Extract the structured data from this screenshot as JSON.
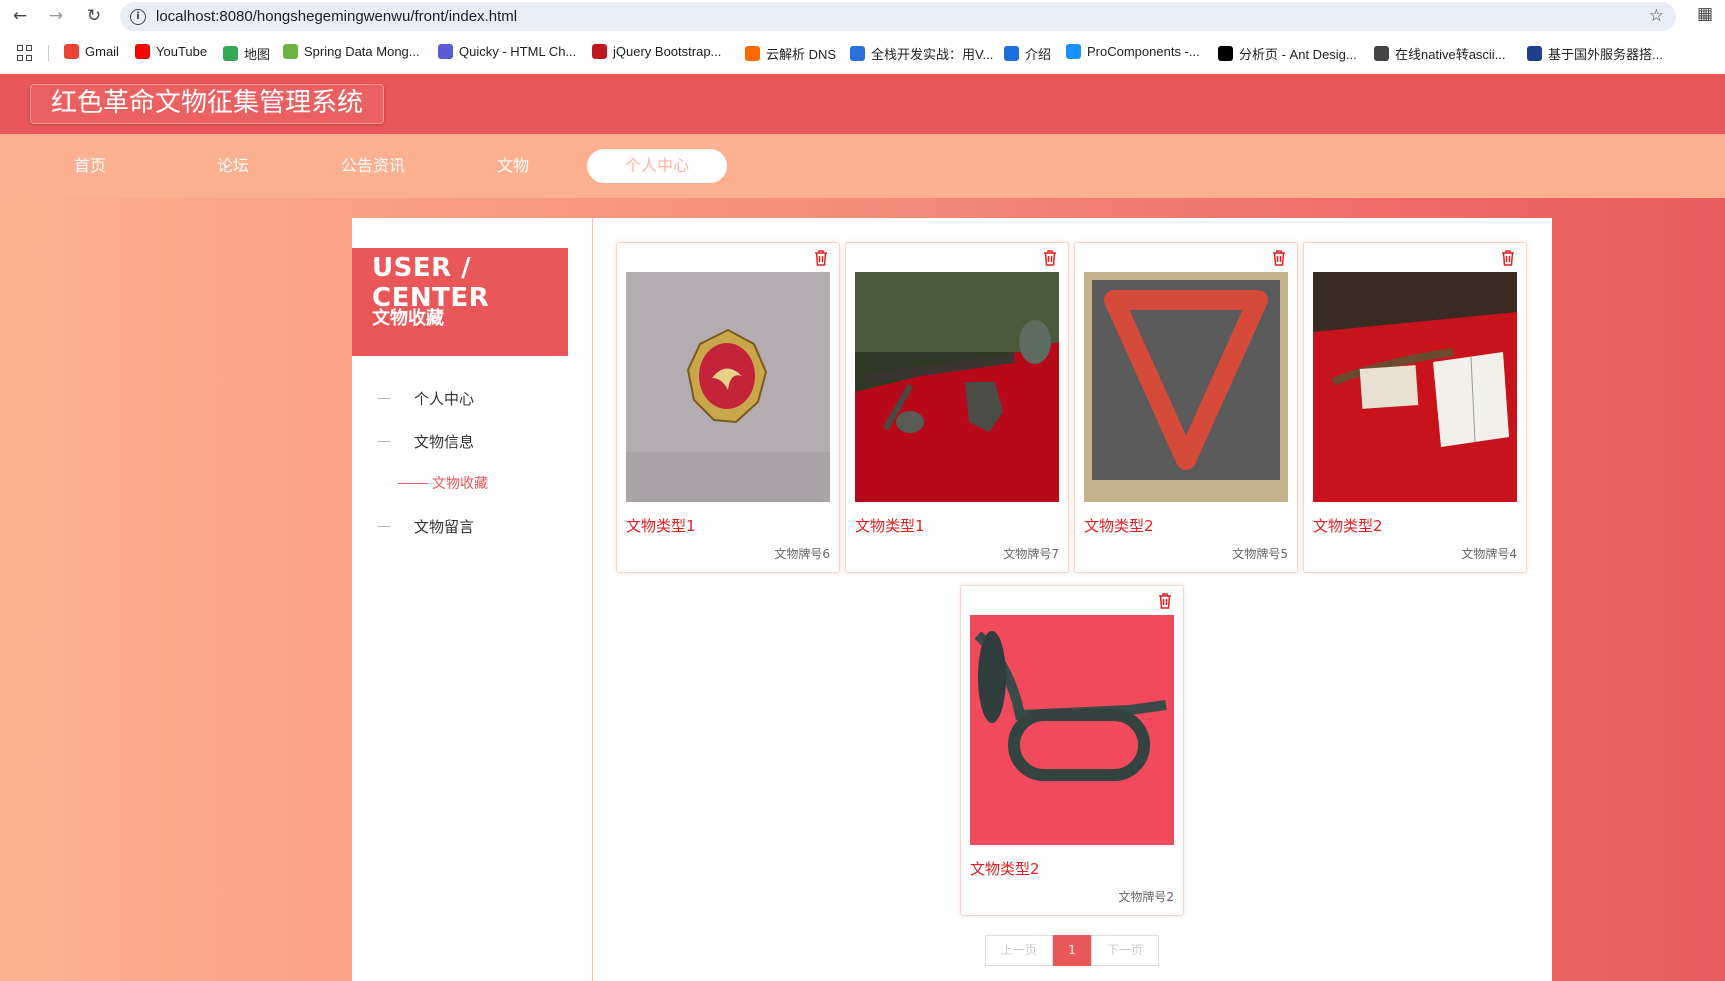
{
  "browser": {
    "url": "localhost:8080/hongshegemingwenwu/front/index.html",
    "bookmarks": [
      {
        "label": "Gmail",
        "icon": "gmail-icon",
        "color": "#ea4335"
      },
      {
        "label": "YouTube",
        "icon": "youtube-icon",
        "color": "#ff0000"
      },
      {
        "label": "地图",
        "icon": "maps-icon",
        "color": "#34a853"
      },
      {
        "label": "Spring Data Mong...",
        "icon": "spring-icon",
        "color": "#6db33f"
      },
      {
        "label": "Quicky - HTML Ch...",
        "icon": "messenger-icon",
        "color": "#5b5bd6"
      },
      {
        "label": "jQuery Bootstrap...",
        "icon": "jquery-icon",
        "color": "#c0161d"
      },
      {
        "label": "云解析 DNS",
        "icon": "aliyun-icon",
        "color": "#ff6a00"
      },
      {
        "label": "全栈开发实战：用V...",
        "icon": "m-icon",
        "color": "#2a6fdb"
      },
      {
        "label": "介绍",
        "icon": "globe-icon",
        "color": "#1e6fd9"
      },
      {
        "label": "ProComponents -...",
        "icon": "procomponents-icon",
        "color": "#1890ff"
      },
      {
        "label": "分析页 - Ant Desig...",
        "icon": "pro-icon",
        "color": "#000000"
      },
      {
        "label": "在线native转ascii...",
        "icon": "github-icon",
        "color": "#444444"
      },
      {
        "label": "基于国外服务器搭...",
        "icon": "docker-icon",
        "color": "#1d3f8c"
      }
    ]
  },
  "header": {
    "title": "红色革命文物征集管理系统"
  },
  "nav": {
    "items": [
      "首页",
      "论坛",
      "公告资讯",
      "文物",
      "个人中心"
    ],
    "active_index": 4
  },
  "sidebar": {
    "uc_title": "USER / CENTER",
    "uc_subtitle": "文物收藏",
    "items": [
      "个人中心",
      "文物信息",
      "文物留言"
    ],
    "sub_item": "文物收藏"
  },
  "cards": [
    {
      "title": "文物类型1",
      "number": "文物牌号6",
      "image": "badge"
    },
    {
      "title": "文物类型1",
      "number": "文物牌号7",
      "image": "weapons"
    },
    {
      "title": "文物类型2",
      "number": "文物牌号5",
      "image": "scarf"
    },
    {
      "title": "文物类型2",
      "number": "文物牌号4",
      "image": "display"
    },
    {
      "title": "文物类型2",
      "number": "文物牌号2",
      "image": "bugle"
    }
  ],
  "pager": {
    "prev": "上一页",
    "current": "1",
    "next": "下一页"
  },
  "colors": {
    "primary": "#ea5758",
    "nav_bg": "#fdb08f",
    "title_red": "#e02020"
  }
}
